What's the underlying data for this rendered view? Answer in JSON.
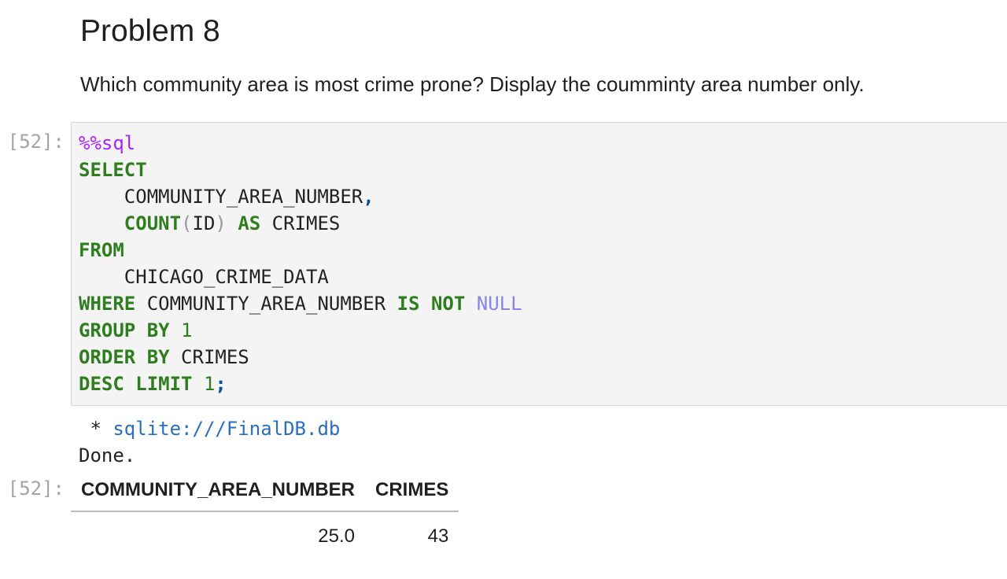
{
  "markdown": {
    "heading": "Problem 8",
    "question": "Which community area is most crime prone? Display the coumminty area number only."
  },
  "cell": {
    "input_prompt": "[52]:",
    "output_prompt": "[52]:",
    "code": {
      "magic": "%%sql",
      "select": "SELECT",
      "col1": "COMMUNITY_AREA_NUMBER",
      "comma": ",",
      "count_fn": "COUNT",
      "open_paren": "(",
      "count_arg": "ID",
      "close_paren": ")",
      "as_kw": "AS",
      "alias": "CRIMES",
      "from": "FROM",
      "table": "CHICAGO_CRIME_DATA",
      "where": "WHERE",
      "where_col": "COMMUNITY_AREA_NUMBER",
      "is_not": "IS NOT",
      "null": "NULL",
      "group_by": "GROUP BY",
      "group_num": "1",
      "order_by": "ORDER BY",
      "order_col": "CRIMES",
      "desc_limit": "DESC LIMIT",
      "limit_num": "1",
      "semicolon": ";"
    },
    "stream": {
      "bullet": " * ",
      "connection": "sqlite:///FinalDB.db",
      "done": "Done."
    },
    "result": {
      "headers": [
        "COMMUNITY_AREA_NUMBER",
        "CRIMES"
      ],
      "rows": [
        [
          "25.0",
          "43"
        ]
      ]
    }
  },
  "colors": {
    "keyword": "#2e7d1f",
    "magic": "#aa22ff",
    "null": "#8a84ea",
    "link": "#2a6fbb",
    "prompt": "#a4a4a4"
  }
}
